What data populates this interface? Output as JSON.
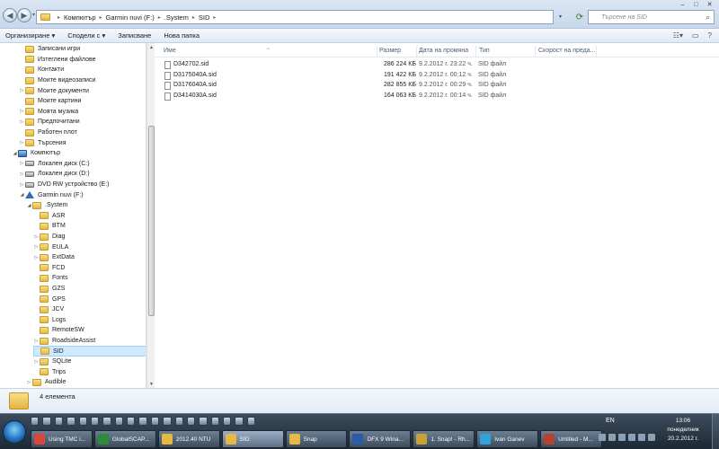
{
  "window": {
    "minimize": "‒",
    "maximize": "□",
    "close": "✕"
  },
  "address": {
    "crumbs": [
      "Компютър",
      "Garmin nuvi (F:)",
      ".System",
      "SID"
    ],
    "search_placeholder": "Търсене на SID"
  },
  "toolbar": {
    "organize": "Организиране ▾",
    "share": "Сподели с ▾",
    "burn": "Записване",
    "new_folder": "Нова папка"
  },
  "nav": {
    "items": [
      {
        "label": "Записани игри",
        "level": 1,
        "icon": "folder-icon",
        "expand": ""
      },
      {
        "label": "Изтеглени файлове",
        "level": 1,
        "icon": "folder-icon",
        "expand": ""
      },
      {
        "label": "Контакти",
        "level": 1,
        "icon": "folder-icon",
        "expand": ""
      },
      {
        "label": "Моите видеозаписи",
        "level": 1,
        "icon": "folder-icon",
        "expand": ""
      },
      {
        "label": "Моите документи",
        "level": 1,
        "icon": "folder-icon",
        "expand": "▷"
      },
      {
        "label": "Моите картини",
        "level": 1,
        "icon": "folder-icon",
        "expand": ""
      },
      {
        "label": "Моята музика",
        "level": 1,
        "icon": "folder-icon",
        "expand": "▷"
      },
      {
        "label": "Предпочитани",
        "level": 1,
        "icon": "folder-icon",
        "expand": "▷"
      },
      {
        "label": "Работен плот",
        "level": 1,
        "icon": "folder-icon",
        "expand": ""
      },
      {
        "label": "Търсения",
        "level": 1,
        "icon": "folder-icon",
        "expand": "▷"
      },
      {
        "label": "Компютър",
        "level": 0,
        "icon": "computer-icon",
        "expand": "◢"
      },
      {
        "label": "Локален диск (C:)",
        "level": 1,
        "icon": "drive-icon",
        "expand": "▷"
      },
      {
        "label": "Локален диск (D:)",
        "level": 1,
        "icon": "drive-icon",
        "expand": "▷"
      },
      {
        "label": "DVD RW устройство (E:)",
        "level": 1,
        "icon": "drive-icon",
        "expand": "▷"
      },
      {
        "label": "Garmin nuvi (F:)",
        "level": 1,
        "icon": "garmin-icon",
        "expand": "◢"
      },
      {
        "label": ".System",
        "level": 2,
        "icon": "folder-icon",
        "expand": "◢"
      },
      {
        "label": "ASR",
        "level": 3,
        "icon": "folder-icon",
        "expand": ""
      },
      {
        "label": "BTM",
        "level": 3,
        "icon": "folder-icon",
        "expand": ""
      },
      {
        "label": "Diag",
        "level": 3,
        "icon": "folder-icon",
        "expand": "▷"
      },
      {
        "label": "EULA",
        "level": 3,
        "icon": "folder-icon",
        "expand": "▷"
      },
      {
        "label": "ExtData",
        "level": 3,
        "icon": "folder-icon",
        "expand": "▷"
      },
      {
        "label": "FCD",
        "level": 3,
        "icon": "folder-icon",
        "expand": ""
      },
      {
        "label": "Fonts",
        "level": 3,
        "icon": "folder-icon",
        "expand": ""
      },
      {
        "label": "GZS",
        "level": 3,
        "icon": "folder-icon",
        "expand": ""
      },
      {
        "label": "GPS",
        "level": 3,
        "icon": "folder-icon",
        "expand": ""
      },
      {
        "label": "JCV",
        "level": 3,
        "icon": "folder-icon",
        "expand": ""
      },
      {
        "label": "Logs",
        "level": 3,
        "icon": "folder-icon",
        "expand": ""
      },
      {
        "label": "RemoteSW",
        "level": 3,
        "icon": "folder-icon",
        "expand": ""
      },
      {
        "label": "RoadsideAssist",
        "level": 3,
        "icon": "folder-icon",
        "expand": "▷"
      },
      {
        "label": "SID",
        "level": 3,
        "icon": "folder-icon",
        "expand": "",
        "selected": true
      },
      {
        "label": "SQLite",
        "level": 3,
        "icon": "folder-icon",
        "expand": "▷"
      },
      {
        "label": "Trips",
        "level": 3,
        "icon": "folder-icon",
        "expand": ""
      },
      {
        "label": "Audible",
        "level": 2,
        "icon": "folder-icon",
        "expand": "▷"
      }
    ]
  },
  "columns": {
    "name": "Име",
    "size": "Размер",
    "date": "Дата на промяна",
    "type": "Тип",
    "speed": "Скорост на преда..."
  },
  "files": [
    {
      "name": "D342702.sid",
      "size": "286 224 КБ",
      "date": "9.2.2012 г. 23:22 ч.",
      "type": "SID файл"
    },
    {
      "name": "D3175040A.sid",
      "size": "191 422 КБ",
      "date": "9.2.2012 г. 00:12 ч.",
      "type": "SID файл"
    },
    {
      "name": "D3176040A.sid",
      "size": "282 855 КБ",
      "date": "9.2.2012 г. 00:29 ч.",
      "type": "SID файл"
    },
    {
      "name": "D3414030A.sid",
      "size": "164 063 КБ",
      "date": "9.2.2012 г. 00:14 ч.",
      "type": "SID файл"
    }
  ],
  "details": {
    "count": "4 елемента"
  },
  "taskbar": {
    "tasks": [
      {
        "label": "Using TMC i...",
        "color": "#d9463a",
        "active": false
      },
      {
        "label": "GlobalSCAP...",
        "color": "#2f8a3c",
        "active": false
      },
      {
        "label": "2012.40 NTU",
        "color": "#e5b944",
        "active": false
      },
      {
        "label": "SID",
        "color": "#e5b944",
        "active": true
      },
      {
        "label": "Snap",
        "color": "#e5b944",
        "active": false
      },
      {
        "label": "DFX 9 Wina...",
        "color": "#2b5ca8",
        "active": false
      },
      {
        "label": "1. Snap! - Rh...",
        "color": "#c9a038",
        "active": false
      },
      {
        "label": "Ivan Ganev",
        "color": "#2fa3dc",
        "active": false
      },
      {
        "label": "Untitled - M...",
        "color": "#b84030",
        "active": false
      }
    ],
    "lang": "EN",
    "time": "13:06",
    "weekday": "понеделник",
    "date": "20.2.2012 г."
  }
}
